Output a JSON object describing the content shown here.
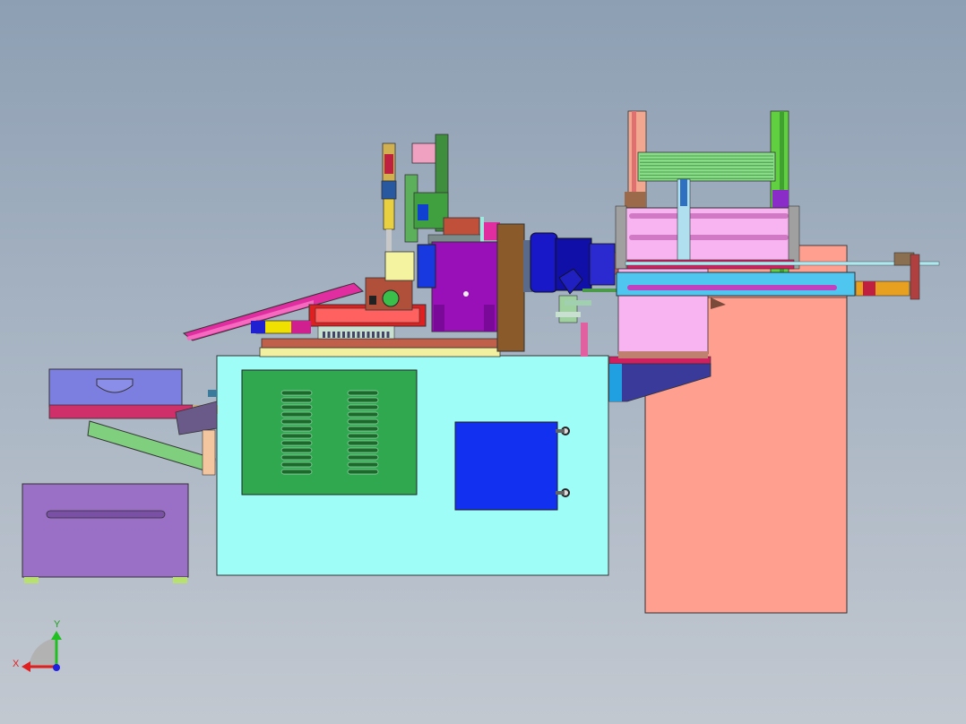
{
  "view": {
    "triad": {
      "x_label": "X",
      "y_label": "Y"
    }
  },
  "colors": {
    "background_top": "#8d9fb3",
    "background_bottom": "#c2c8d0",
    "cabinet": "#9ffdf8",
    "right_frame": "#ff9f8f",
    "panel_green": "#2fa84f",
    "blue_box": "#1230f0",
    "drawer_purple": "#9a6fc6",
    "top_drawer": "#7d7fe0",
    "magenta_slide": "#e02ea0",
    "motor_blue": "#1818c8",
    "purple_block": "#9a10b8",
    "brown_plate": "#8b5a2b",
    "pink_frame": "#f8b4f0"
  },
  "labels": {
    "icons": [
      "axis-triad-icon",
      "vent-slot-icon",
      "drawer-handle-icon"
    ]
  }
}
